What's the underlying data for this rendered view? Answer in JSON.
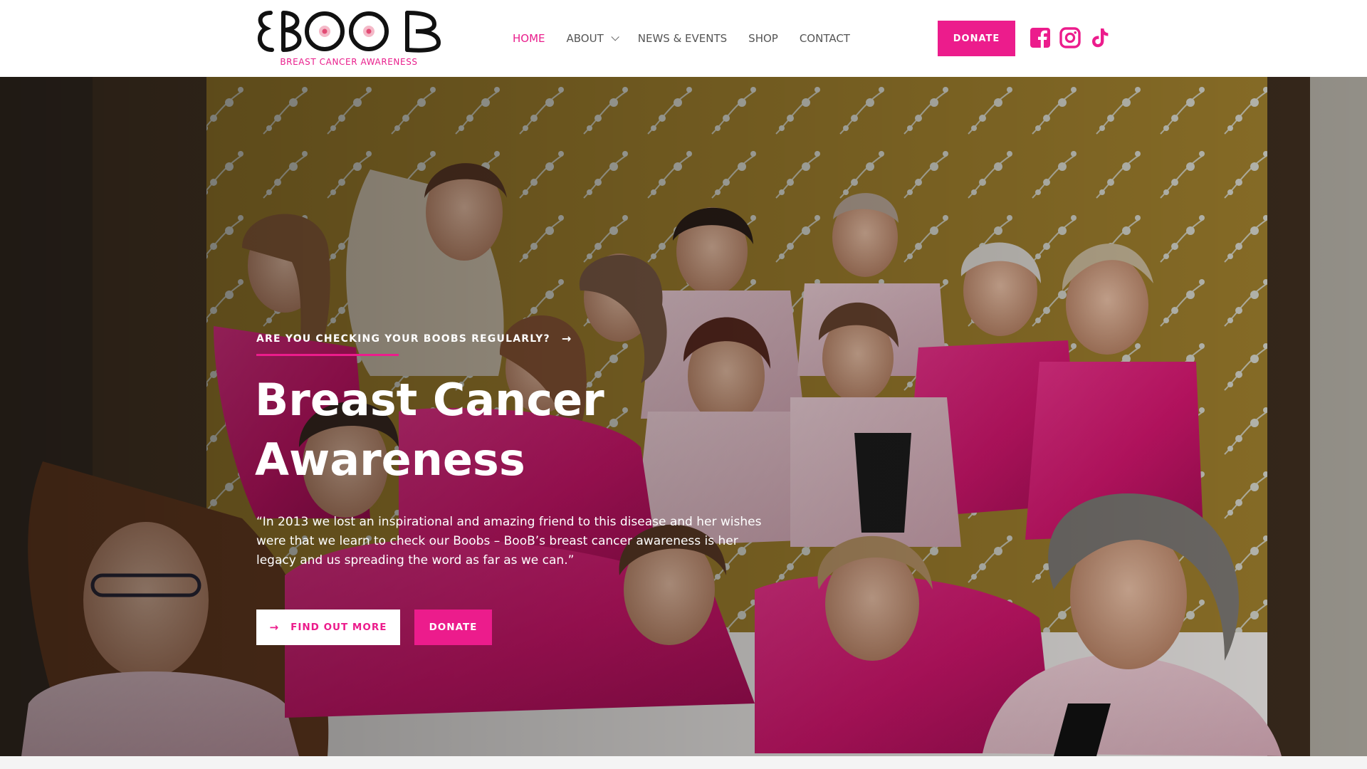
{
  "brand": {
    "logo_text": "BOOBS",
    "tagline": "BREAST CANCER AWARENESS",
    "accent": "#ec1c8c"
  },
  "nav": {
    "items": [
      {
        "label": "HOME",
        "active": true
      },
      {
        "label": "ABOUT",
        "has_dropdown": true
      },
      {
        "label": "NEWS & EVENTS"
      },
      {
        "label": "SHOP"
      },
      {
        "label": "CONTACT"
      }
    ],
    "donate_label": "DONATE",
    "social_icons": [
      "facebook-icon",
      "instagram-icon",
      "tiktok-icon"
    ]
  },
  "hero": {
    "eyebrow": "ARE YOU CHECKING YOUR BOOBS REGULARLY?",
    "eyebrow_icon": "arrow-right-icon",
    "title_line1": "Breast Cancer",
    "title_line2": "Awareness",
    "quote": "“In 2013 we lost an inspirational and amazing friend to this disease and her wishes were that we learn to check our Boobs – BooB’s breast cancer awareness is her legacy and us spreading the word as far as we can.”",
    "primary_button": "FIND OUT MORE",
    "primary_button_icon": "arrow-right-icon",
    "secondary_button": "DONATE",
    "background_image": "group-photo-pink-robes"
  }
}
